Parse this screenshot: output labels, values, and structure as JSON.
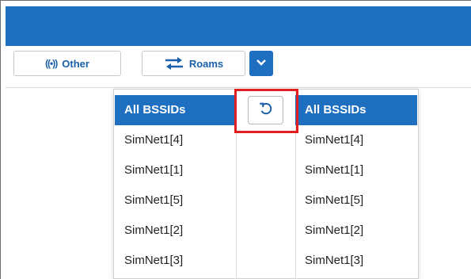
{
  "toolbar": {
    "other_label": "Other",
    "roams_label": "Roams",
    "other_icon": "radio-signal-icon",
    "roams_icon": "swap-arrows-icon",
    "dropdown_icon": "chevron-down-icon"
  },
  "reset": {
    "icon": "reset-icon"
  },
  "left_list": {
    "items": [
      "All BSSIDs",
      "SimNet1[4]",
      "SimNet1[1]",
      "SimNet1[5]",
      "SimNet1[2]",
      "SimNet1[3]"
    ],
    "selected": "All BSSIDs"
  },
  "right_list": {
    "items": [
      "All BSSIDs",
      "SimNet1[4]",
      "SimNet1[1]",
      "SimNet1[5]",
      "SimNet1[2]",
      "SimNet1[3]"
    ],
    "selected": "All BSSIDs"
  },
  "colors": {
    "accent": "#1e6fbf",
    "highlight": "#e02020"
  }
}
